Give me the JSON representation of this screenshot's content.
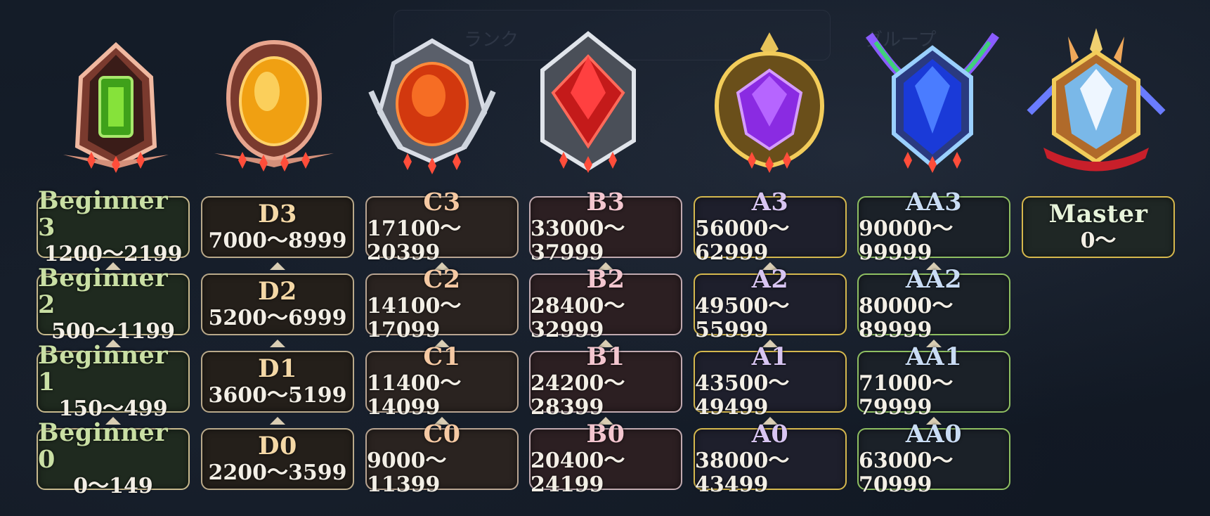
{
  "ranks": {
    "beginner": {
      "color": "#c9dfa4",
      "tiers": [
        {
          "name": "Beginner 3",
          "range": "1200〜2199"
        },
        {
          "name": "Beginner 2",
          "range": "500〜1199"
        },
        {
          "name": "Beginner 1",
          "range": "150〜499"
        },
        {
          "name": "Beginner 0",
          "range": "0〜149"
        }
      ]
    },
    "d": {
      "color": "#f4d8a6",
      "tiers": [
        {
          "name": "D3",
          "range": "7000〜8999"
        },
        {
          "name": "D2",
          "range": "5200〜6999"
        },
        {
          "name": "D1",
          "range": "3600〜5199"
        },
        {
          "name": "D0",
          "range": "2200〜3599"
        }
      ]
    },
    "c": {
      "color": "#f5c9a3",
      "tiers": [
        {
          "name": "C3",
          "range": "17100〜20399"
        },
        {
          "name": "C2",
          "range": "14100〜17099"
        },
        {
          "name": "C1",
          "range": "11400〜14099"
        },
        {
          "name": "C0",
          "range": "9000〜11399"
        }
      ]
    },
    "b": {
      "color": "#f3c6cf",
      "tiers": [
        {
          "name": "B3",
          "range": "33000〜37999"
        },
        {
          "name": "B2",
          "range": "28400〜32999"
        },
        {
          "name": "B1",
          "range": "24200〜28399"
        },
        {
          "name": "B0",
          "range": "20400〜24199"
        }
      ]
    },
    "a": {
      "color": "#d8c5f2",
      "tiers": [
        {
          "name": "A3",
          "range": "56000〜62999"
        },
        {
          "name": "A2",
          "range": "49500〜55999"
        },
        {
          "name": "A1",
          "range": "43500〜49499"
        },
        {
          "name": "A0",
          "range": "38000〜43499"
        }
      ]
    },
    "aa": {
      "color": "#c9dcf4",
      "tiers": [
        {
          "name": "AA3",
          "range": "90000〜99999"
        },
        {
          "name": "AA2",
          "range": "80000〜89999"
        },
        {
          "name": "AA1",
          "range": "71000〜79999"
        },
        {
          "name": "AA0",
          "range": "63000〜70999"
        }
      ]
    },
    "master": {
      "color": "#e6f3da",
      "tiers": [
        {
          "name": "Master",
          "range": "0〜"
        }
      ]
    }
  },
  "background": {
    "rank_tab": "ランク",
    "group_tab": "グループ"
  },
  "badge_icons": [
    "emerald-badge-icon",
    "amber-badge-icon",
    "flame-badge-icon",
    "ruby-badge-icon",
    "amethyst-badge-icon",
    "sapphire-badge-icon",
    "diamond-badge-icon"
  ]
}
